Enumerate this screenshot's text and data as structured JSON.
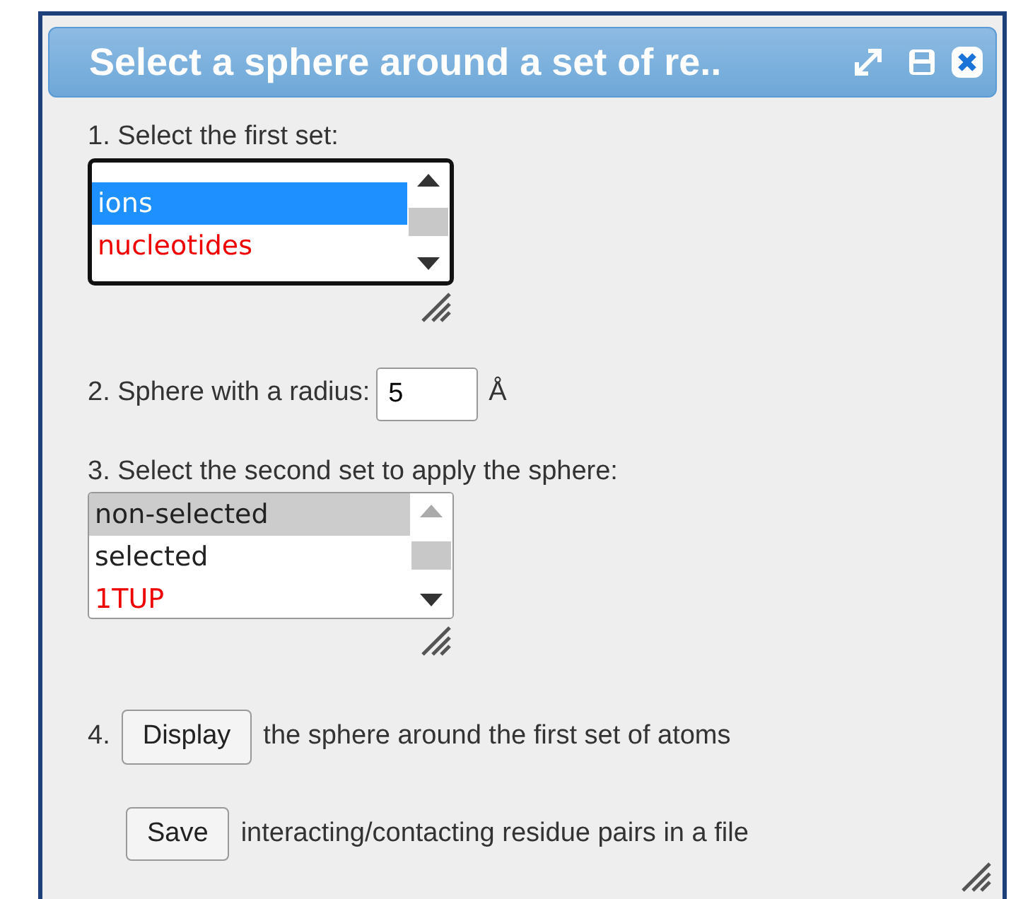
{
  "dialog": {
    "title": "Select a sphere around a set of re..",
    "step1": {
      "label": "1. Select the first set:",
      "focused": true,
      "options": [
        {
          "text": "ions",
          "selected": true,
          "color": "#ffffff"
        },
        {
          "text": "nucleotides",
          "selected": false,
          "color": "#ee0000"
        }
      ]
    },
    "step2": {
      "label": "2. Sphere with a radius:",
      "value": "5",
      "unit": "Å"
    },
    "step3": {
      "label": "3. Select the second set to apply the sphere:",
      "focused": false,
      "options": [
        {
          "text": "non-selected",
          "selected": true,
          "color": "#222222"
        },
        {
          "text": "selected",
          "selected": false,
          "color": "#222222"
        },
        {
          "text": "1TUP",
          "selected": false,
          "color": "#ee0000"
        }
      ]
    },
    "step4": {
      "number": "4.",
      "button": "Display",
      "text": "the sphere around the first set of atoms"
    },
    "save": {
      "button": "Save",
      "text": "interacting/contacting residue pairs in a file"
    }
  }
}
